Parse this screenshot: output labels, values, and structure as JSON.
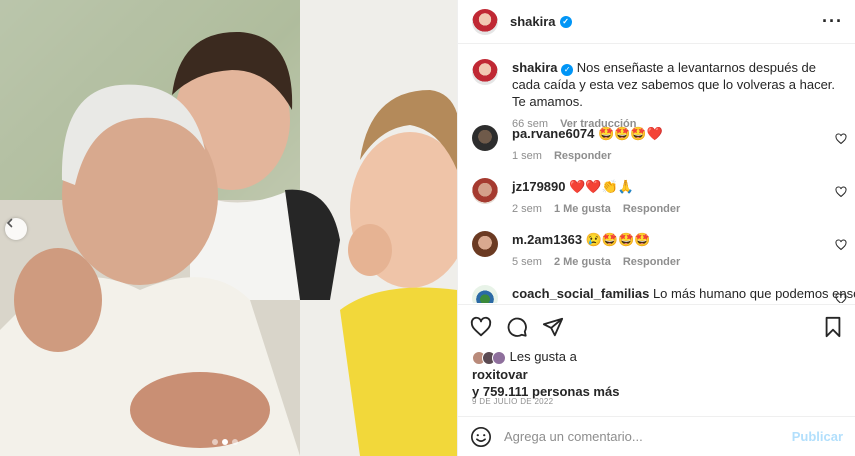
{
  "post": {
    "username": "shakira",
    "caption": "Nos enseñaste a levantarnos después de cada caída y esta vez sabemos que lo volveras a hacer. Te amamos.",
    "caption_time": "66 sem",
    "translate_label": "Ver traducción",
    "more_icon": "more-options-icon",
    "photo_slide": 2,
    "photo_slides_total": 3
  },
  "comments": [
    {
      "user": "pa.rvane6074",
      "text": "🤩🤩🤩❤️",
      "time": "1 sem",
      "likes": "",
      "reply": "Responder"
    },
    {
      "user": "jz179890",
      "text": "❤️❤️👏🙏",
      "time": "2 sem",
      "likes": "1 Me gusta",
      "reply": "Responder"
    },
    {
      "user": "m.2am1363",
      "text": "😢🤩🤩🤩",
      "time": "5 sem",
      "likes": "2 Me gusta",
      "reply": "Responder"
    },
    {
      "user": "coach_social_familias",
      "text": "Lo más humano que podemos enseñar a",
      "time": "",
      "likes": "",
      "reply": ""
    }
  ],
  "likes": {
    "prefix": "Les gusta a",
    "first_user": "roxitovar",
    "rest": "y 759.111 personas más"
  },
  "date": "9 DE JULIO DE 2022",
  "add_comment": {
    "placeholder": "Agrega un comentario...",
    "publish_label": "Publicar"
  },
  "colors": {
    "verified": "#0095f6",
    "publish_disabled": "#b2dffc",
    "muted": "#8e8e8e"
  }
}
